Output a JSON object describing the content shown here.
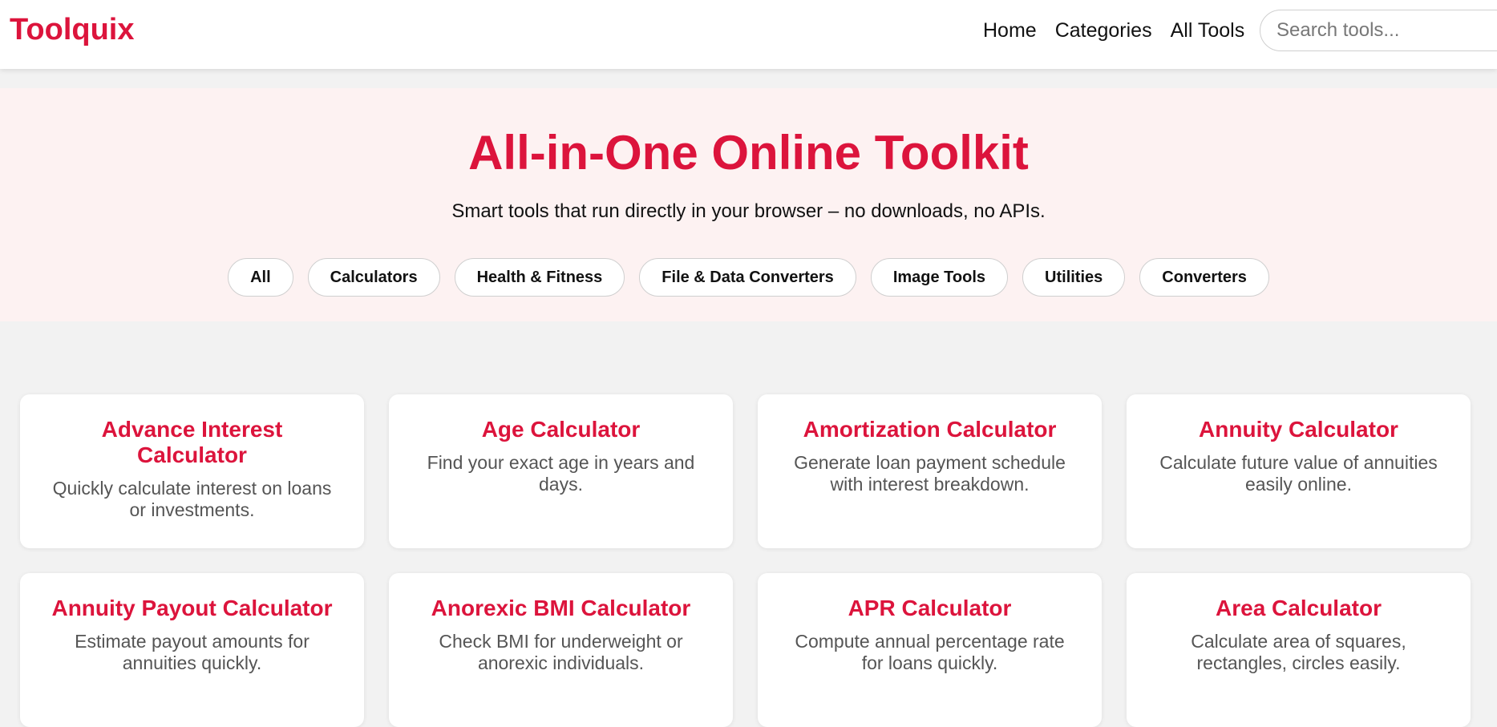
{
  "header": {
    "logo": "Toolquix",
    "nav": [
      "Home",
      "Categories",
      "All Tools"
    ],
    "search_placeholder": "Search tools..."
  },
  "hero": {
    "title": "All-in-One Online Toolkit",
    "subtitle": "Smart tools that run directly in your browser – no downloads, no APIs.",
    "categories": [
      "All",
      "Calculators",
      "Health & Fitness",
      "File & Data Converters",
      "Image Tools",
      "Utilities",
      "Converters"
    ]
  },
  "tools": [
    {
      "title": "Advance Interest Calculator",
      "desc": "Quickly calculate interest on loans or investments."
    },
    {
      "title": "Age Calculator",
      "desc": "Find your exact age in years and days."
    },
    {
      "title": "Amortization Calculator",
      "desc": "Generate loan payment schedule with interest breakdown."
    },
    {
      "title": "Annuity Calculator",
      "desc": "Calculate future value of annuities easily online."
    },
    {
      "title": "Annuity Payout Calculator",
      "desc": "Estimate payout amounts for annuities quickly."
    },
    {
      "title": "Anorexic BMI Calculator",
      "desc": "Check BMI for underweight or anorexic individuals."
    },
    {
      "title": "APR Calculator",
      "desc": "Compute annual percentage rate for loans quickly."
    },
    {
      "title": "Area Calculator",
      "desc": "Calculate area of squares, rectangles, circles easily."
    }
  ],
  "colors": {
    "accent": "#dc143c",
    "hero_bg": "#fdf2f2",
    "page_bg": "#f2f2f2"
  }
}
